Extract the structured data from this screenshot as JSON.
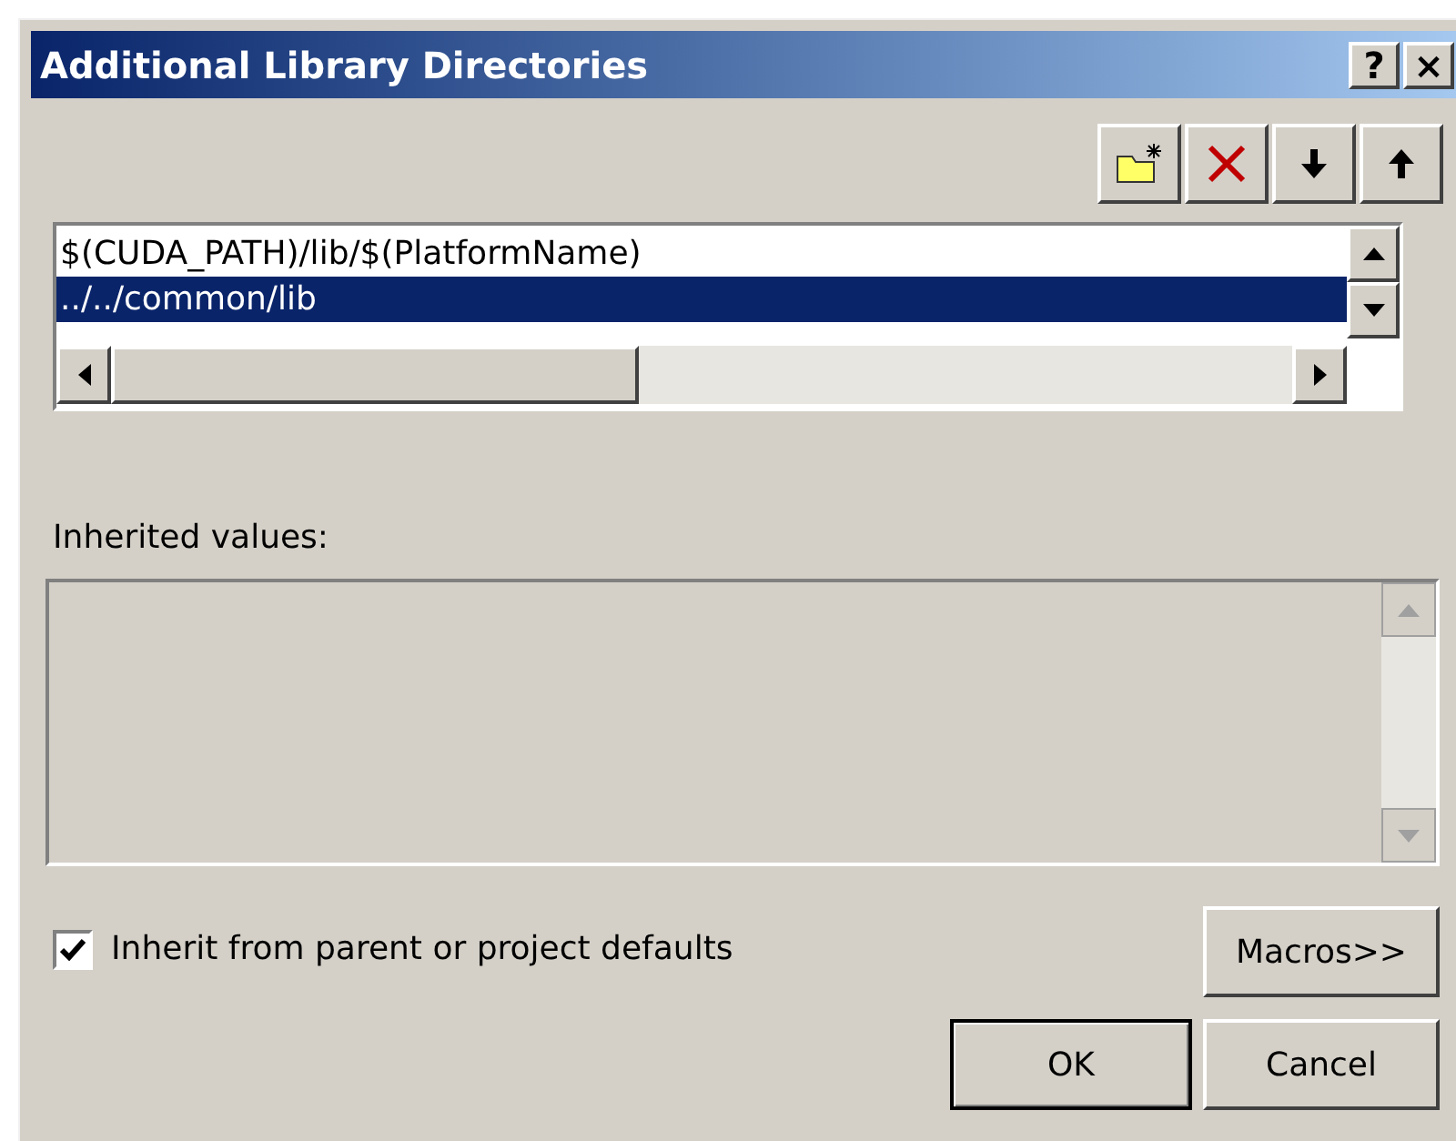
{
  "window": {
    "title": "Additional Library Directories",
    "title_buttons": [
      "?",
      "×"
    ]
  },
  "list": {
    "items": [
      {
        "text": "$(CUDA_PATH)/lib/$(PlatformName)",
        "selected": false
      },
      {
        "text": "../../common/lib",
        "selected": true
      }
    ]
  },
  "inherited": {
    "label": "Inherited values:"
  },
  "inherit_checkbox": {
    "label": "Inherit from parent or project defaults",
    "checked": true
  },
  "buttons": {
    "macros": "Macros>>",
    "ok": "OK",
    "cancel": "Cancel"
  }
}
